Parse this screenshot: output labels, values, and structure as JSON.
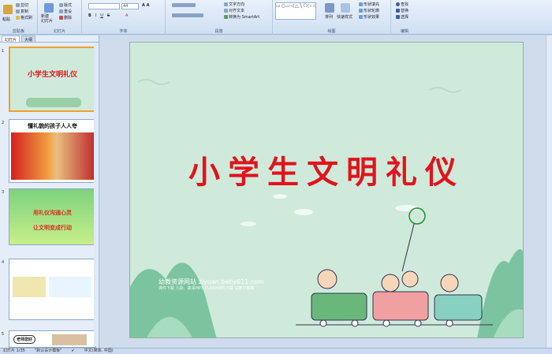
{
  "ribbon": {
    "clipboard": {
      "paste": "粘贴",
      "cut": "剪切",
      "copy": "复制",
      "format_painter": "格式刷",
      "label": "剪贴板"
    },
    "slides": {
      "new_slide": "新建\n幻灯片",
      "layout": "版式",
      "reset": "重设",
      "delete": "删除",
      "label": "幻灯片"
    },
    "font": {
      "size": "44",
      "label": "字体"
    },
    "paragraph": {
      "text_direction": "文字方向",
      "align_text": "对齐文本",
      "smartart": "转换为 SmartArt",
      "label": "段落"
    },
    "drawing": {
      "arrange": "排列",
      "quick_styles": "快速样式",
      "shape_fill": "形状填充",
      "shape_outline": "形状轮廓",
      "shape_effects": "形状效果",
      "label": "绘图"
    },
    "editing": {
      "find": "查找",
      "replace": "替换",
      "select": "选择",
      "label": "编辑"
    }
  },
  "pane": {
    "tabs": [
      "幻灯片",
      "大纲"
    ],
    "slide_numbers": [
      "1",
      "2",
      "3",
      "4",
      "5"
    ],
    "thumbs": [
      {
        "title": "小学生文明礼仪"
      },
      {
        "title": "懂礼貌的孩子人人夸"
      },
      {
        "line1": "用礼仪沟通心灵",
        "line2": "让文明变成行动"
      },
      {
        "title": ""
      },
      {
        "title": "老师您好"
      }
    ]
  },
  "slide": {
    "title": "小学生文明礼仪",
    "watermark": "幼教资源网站 ziyuan.baby611.com",
    "watermark_sub": "课件下载  儿歌、故事MP3  FLASH课件下载  试卷下载等"
  },
  "status": {
    "slide_count": "幻灯片 1/35",
    "theme": "\"默认设计模板\"",
    "language": "中文(简体, 中国)"
  }
}
